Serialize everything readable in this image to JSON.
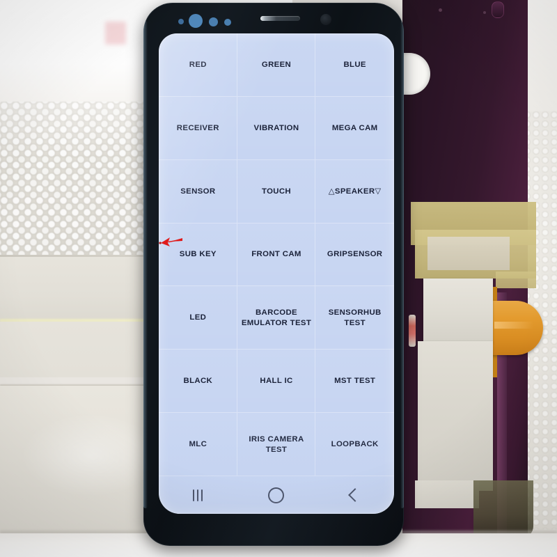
{
  "scene": {
    "description": "Samsung Galaxy S8 phone displaying LCD factory test mode grid menu, photographed on white packing foam next to a disassembled purple phone back panel with masking tape and an orange flex cable",
    "annotation": {
      "type": "red-arrow",
      "direction": "left",
      "color": "#e01b1b",
      "points_at": "left curved screen edge near SUB KEY row"
    }
  },
  "phone": {
    "body_color": "#101620",
    "bezel_color": "#0c1116",
    "top_bezel": {
      "sensor_dots_color": "#4f83b4",
      "earpiece": "earpiece-speaker-slit",
      "front_camera": "front-camera-lens"
    }
  },
  "screen": {
    "background_color": "#c7d5f2",
    "text_color": "#1b2239",
    "columns": 3,
    "rows": 7,
    "grid_items": [
      {
        "label": "RED"
      },
      {
        "label": "GREEN"
      },
      {
        "label": "BLUE"
      },
      {
        "label": "RECEIVER"
      },
      {
        "label": "VIBRATION"
      },
      {
        "label": "MEGA CAM"
      },
      {
        "label": "SENSOR"
      },
      {
        "label": "TOUCH"
      },
      {
        "label": "△SPEAKER▽"
      },
      {
        "label": "SUB KEY"
      },
      {
        "label": "FRONT CAM"
      },
      {
        "label": "GRIPSENSOR"
      },
      {
        "label": "LED"
      },
      {
        "label": "BARCODE\nEMULATOR TEST"
      },
      {
        "label": "SENSORHUB TEST"
      },
      {
        "label": "BLACK"
      },
      {
        "label": "HALL IC"
      },
      {
        "label": "MST TEST"
      },
      {
        "label": "MLC"
      },
      {
        "label": "IRIS CAMERA TEST"
      },
      {
        "label": "LOOPBACK"
      }
    ]
  },
  "navbar": {
    "buttons": [
      {
        "name": "recents",
        "icon": "recents-icon"
      },
      {
        "name": "home",
        "icon": "home-circle-icon"
      },
      {
        "name": "back",
        "icon": "back-chevron-icon"
      }
    ]
  },
  "background": {
    "left": "white styrofoam packing foam blocks",
    "right": "purple phone back panel with yellow masking tape, white paper tape and orange flex cable",
    "accent_pink": "#f6d5d8",
    "tape_yellow": "#c6b87a",
    "flex_orange": "#e39a2d",
    "panel_purple": "#4a1f3c"
  }
}
